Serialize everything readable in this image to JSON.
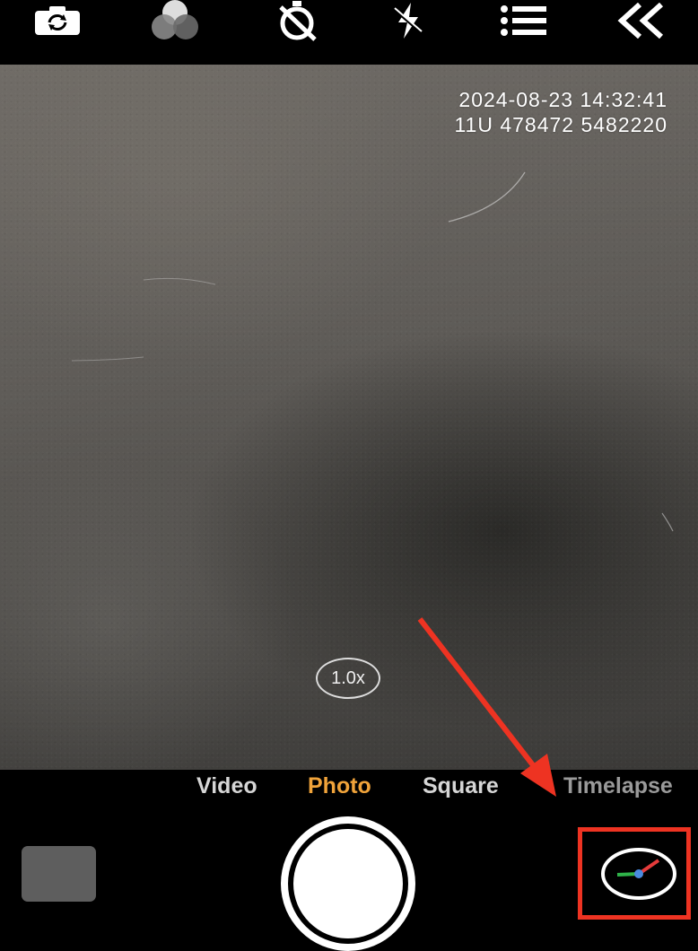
{
  "overlay": {
    "datetime": "2024-08-23 14:32:41",
    "coordinates": "11U 478472 5482220"
  },
  "zoom": {
    "label": "1.0x"
  },
  "modes": [
    {
      "label": "Video",
      "active": false
    },
    {
      "label": "Photo",
      "active": true
    },
    {
      "label": "Square",
      "active": false
    },
    {
      "label": "Timelapse",
      "active": false
    }
  ],
  "toolbar": {
    "icons": [
      "switch-camera-icon",
      "filters-icon",
      "timer-off-icon",
      "flash-off-icon",
      "menu-list-icon",
      "collapse-icon"
    ]
  },
  "colors": {
    "accent_mode": "#f0a33a",
    "annotation_red": "#ee3322"
  }
}
